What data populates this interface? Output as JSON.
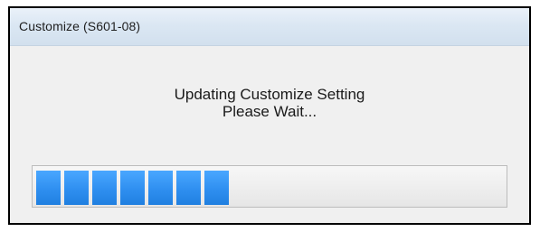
{
  "window": {
    "title": "Customize (S601-08)"
  },
  "message": {
    "line1": "Updating Customize Setting",
    "line2": "Please Wait..."
  },
  "progress": {
    "completed_segments": 7,
    "total_segments": 17,
    "fraction": 0.41,
    "color": "#2f8ff0"
  }
}
